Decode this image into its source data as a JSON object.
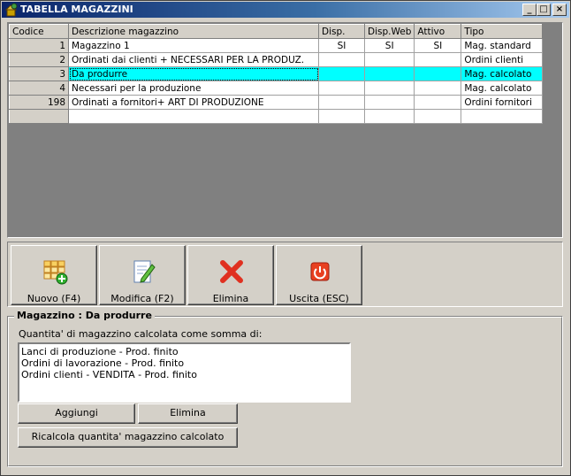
{
  "window": {
    "title": "TABELLA MAGAZZINI"
  },
  "grid": {
    "columns": [
      "Codice",
      "Descrizione magazzino",
      "Disp.",
      "Disp.Web",
      "Attivo",
      "Tipo"
    ],
    "rows": [
      {
        "code": "1",
        "desc": "Magazzino 1",
        "disp": "SI",
        "web": "SI",
        "active": "SI",
        "type": "Mag. standard"
      },
      {
        "code": "2",
        "desc": "Ordinati dai clienti + NECESSARI  PER LA PRODUZ.",
        "disp": "",
        "web": "",
        "active": "",
        "type": "Ordini clienti"
      },
      {
        "code": "3",
        "desc": "Da produrre",
        "disp": "",
        "web": "",
        "active": "",
        "type": "Mag. calcolato"
      },
      {
        "code": "4",
        "desc": "Necessari per la produzione",
        "disp": "",
        "web": "",
        "active": "",
        "type": "Mag. calcolato"
      },
      {
        "code": "198",
        "desc": "Ordinati a fornitori+ ART DI PRODUZIONE",
        "disp": "",
        "web": "",
        "active": "",
        "type": "Ordini fornitori"
      },
      {
        "code": "",
        "desc": "",
        "disp": "",
        "web": "",
        "active": "",
        "type": ""
      }
    ],
    "selected_row": 2,
    "selection_color": "#00ffff"
  },
  "toolbar": {
    "new_label": "Nuovo (F4)",
    "edit_label": "Modifica (F2)",
    "delete_label": "Elimina",
    "exit_label": "Uscita (ESC)"
  },
  "details": {
    "group_title": "Magazzino : Da produrre",
    "list_label": "Quantita' di magazzino calcolata come somma di:",
    "items": [
      "Lanci di produzione - Prod. finito",
      "Ordini di lavorazione - Prod. finito",
      "Ordini clienti - VENDITA - Prod. finito"
    ],
    "add_label": "Aggiungi",
    "remove_label": "Elimina",
    "recalc_label": "Ricalcola quantita' magazzino calcolato"
  }
}
